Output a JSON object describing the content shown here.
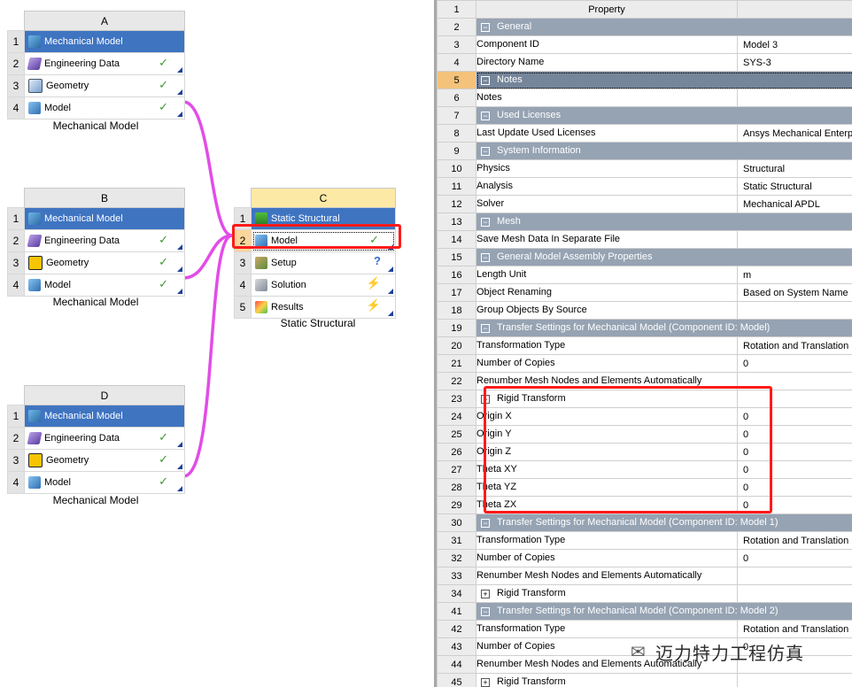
{
  "blocks": {
    "A": {
      "letter": "A",
      "caption": "Mechanical Model",
      "rows": [
        {
          "num": "1",
          "label": "Mechanical Model",
          "icon": "mechanical-model-icon"
        },
        {
          "num": "2",
          "label": "Engineering Data",
          "icon": "engineering-data-icon",
          "status": "✓"
        },
        {
          "num": "3",
          "label": "Geometry",
          "icon": "geometry-icon",
          "status": "✓"
        },
        {
          "num": "4",
          "label": "Model",
          "icon": "model-icon",
          "status": "✓"
        }
      ]
    },
    "B": {
      "letter": "B",
      "caption": "Mechanical Model",
      "rows": [
        {
          "num": "1",
          "label": "Mechanical Model",
          "icon": "mechanical-model-icon"
        },
        {
          "num": "2",
          "label": "Engineering Data",
          "icon": "engineering-data-icon",
          "status": "✓"
        },
        {
          "num": "3",
          "label": "Geometry",
          "icon": "design-modeler-geometry-icon",
          "status": "✓"
        },
        {
          "num": "4",
          "label": "Model",
          "icon": "model-icon",
          "status": "✓"
        }
      ]
    },
    "C": {
      "letter": "C",
      "caption": "Static Structural",
      "rows": [
        {
          "num": "1",
          "label": "Static Structural",
          "icon": "static-structural-icon"
        },
        {
          "num": "2",
          "label": "Model",
          "icon": "model-icon",
          "status": "✓"
        },
        {
          "num": "3",
          "label": "Setup",
          "icon": "setup-icon",
          "status": "?"
        },
        {
          "num": "4",
          "label": "Solution",
          "icon": "solution-icon",
          "status": "⚡"
        },
        {
          "num": "5",
          "label": "Results",
          "icon": "results-icon",
          "status": "⚡"
        }
      ]
    },
    "D": {
      "letter": "D",
      "caption": "Mechanical Model",
      "rows": [
        {
          "num": "1",
          "label": "Mechanical Model",
          "icon": "mechanical-model-icon"
        },
        {
          "num": "2",
          "label": "Engineering Data",
          "icon": "engineering-data-icon",
          "status": "✓"
        },
        {
          "num": "3",
          "label": "Geometry",
          "icon": "design-modeler-geometry-icon",
          "status": "✓"
        },
        {
          "num": "4",
          "label": "Model",
          "icon": "model-icon",
          "status": "✓"
        }
      ]
    }
  },
  "properties": {
    "header": {
      "num": "1",
      "label": "Property"
    },
    "rows": [
      {
        "num": "2",
        "label": "General",
        "group": true
      },
      {
        "num": "3",
        "label": "Component ID",
        "value": "Model 3"
      },
      {
        "num": "4",
        "label": "Directory Name",
        "value": "SYS-3"
      },
      {
        "num": "5",
        "label": "Notes",
        "group": true,
        "selected": true
      },
      {
        "num": "6",
        "label": "Notes",
        "value": ""
      },
      {
        "num": "7",
        "label": "Used Licenses",
        "group": true
      },
      {
        "num": "8",
        "label": "Last Update Used Licenses",
        "value": "Ansys Mechanical Enterpr"
      },
      {
        "num": "9",
        "label": "System Information",
        "group": true
      },
      {
        "num": "10",
        "label": "Physics",
        "value": "Structural"
      },
      {
        "num": "11",
        "label": "Analysis",
        "value": "Static Structural"
      },
      {
        "num": "12",
        "label": "Solver",
        "value": "Mechanical APDL"
      },
      {
        "num": "13",
        "label": "Mesh",
        "group": true
      },
      {
        "num": "14",
        "label": "Save Mesh Data In Separate File",
        "value": ""
      },
      {
        "num": "15",
        "label": "General Model Assembly Properties",
        "group": true
      },
      {
        "num": "16",
        "label": "Length Unit",
        "value": "m"
      },
      {
        "num": "17",
        "label": "Object Renaming",
        "value": "Based on System Name"
      },
      {
        "num": "18",
        "label": "Group Objects By Source",
        "value": ""
      },
      {
        "num": "19",
        "label": "Transfer Settings for Mechanical Model (Component ID: Model)",
        "group": true
      },
      {
        "num": "20",
        "label": "Transformation Type",
        "value": "Rotation and Translation"
      },
      {
        "num": "21",
        "label": "Number of Copies",
        "value": "0"
      },
      {
        "num": "22",
        "label": "Renumber Mesh Nodes and Elements Automatically",
        "value": ""
      },
      {
        "num": "23",
        "label": "Rigid Transform",
        "subgroup": true,
        "expanded": true
      },
      {
        "num": "24",
        "label": "Origin X",
        "value": "0",
        "deep": true
      },
      {
        "num": "25",
        "label": "Origin Y",
        "value": "0",
        "deep": true
      },
      {
        "num": "26",
        "label": "Origin Z",
        "value": "0",
        "deep": true
      },
      {
        "num": "27",
        "label": "Theta XY",
        "value": "0",
        "deep": true
      },
      {
        "num": "28",
        "label": "Theta YZ",
        "value": "0",
        "deep": true
      },
      {
        "num": "29",
        "label": "Theta ZX",
        "value": "0",
        "deep": true
      },
      {
        "num": "30",
        "label": "Transfer Settings for Mechanical Model (Component ID: Model 1)",
        "group": true
      },
      {
        "num": "31",
        "label": "Transformation Type",
        "value": "Rotation and Translation"
      },
      {
        "num": "32",
        "label": "Number of Copies",
        "value": "0"
      },
      {
        "num": "33",
        "label": "Renumber Mesh Nodes and Elements Automatically",
        "value": ""
      },
      {
        "num": "34",
        "label": "Rigid Transform",
        "subgroup": true,
        "expanded": false
      },
      {
        "num": "41",
        "label": "Transfer Settings for Mechanical Model (Component ID: Model 2)",
        "group": true
      },
      {
        "num": "42",
        "label": "Transformation Type",
        "value": "Rotation and Translation"
      },
      {
        "num": "43",
        "label": "Number of Copies",
        "value": "0"
      },
      {
        "num": "44",
        "label": "Renumber Mesh Nodes and Elements Automatically",
        "value": ""
      },
      {
        "num": "45",
        "label": "Rigid Transform",
        "subgroup": true,
        "expanded": false
      }
    ]
  },
  "watermark": "迈力特力工程仿真",
  "colors": {
    "connector": "#e24ce8",
    "highlight": "#ff1a1a",
    "selected_cell": "#3f74c1",
    "group_row": "#96a3b3"
  }
}
